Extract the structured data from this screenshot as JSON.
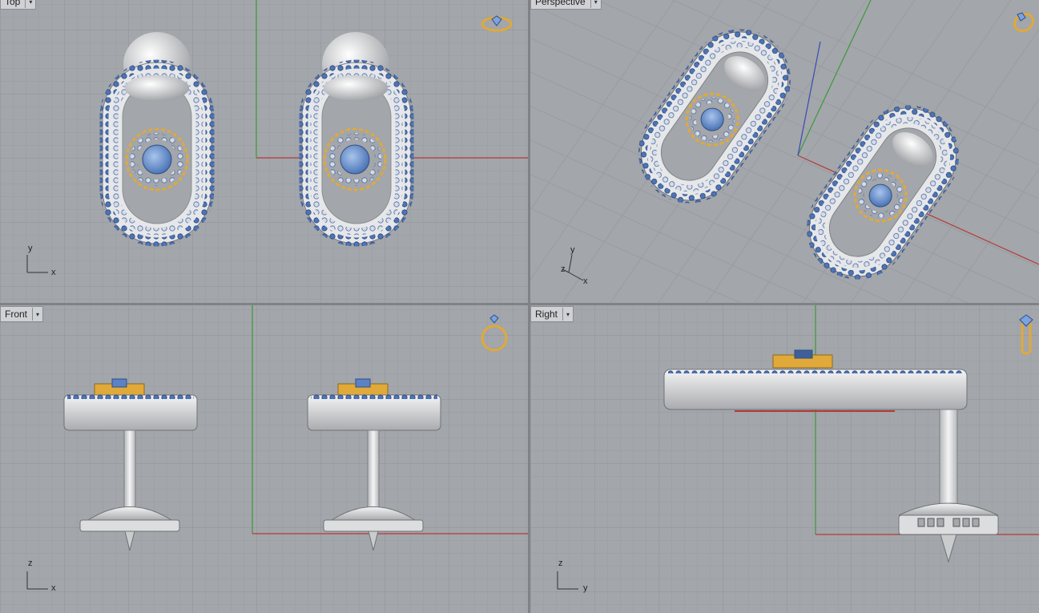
{
  "viewports": {
    "top": {
      "title": "Top",
      "dropdown": "▾",
      "axis_v": "y",
      "axis_h": "x"
    },
    "perspective": {
      "title": "Perspective",
      "dropdown": "▾",
      "axis_v": "y",
      "axis_z": "z",
      "axis_h": "x"
    },
    "front": {
      "title": "Front",
      "dropdown": "▾",
      "axis_v": "z",
      "axis_h": "x"
    },
    "right": {
      "title": "Right",
      "dropdown": "▾",
      "axis_v": "z",
      "axis_h": "y"
    }
  },
  "icons": {
    "top": "ring-top-view-icon",
    "perspective": "ring-perspective-icon",
    "front": "ring-front-view-icon",
    "right": "ring-side-view-icon"
  },
  "colors": {
    "grid_bg": "#a3a6aa",
    "grid_line": "#9a9da1",
    "grid_major": "#8e9195",
    "x_axis": "#b33a3a",
    "y_axis": "#3a9a3a",
    "z_axis": "#3a4ab3",
    "gem_blue": "#5b82c6",
    "gold": "#e0a93a",
    "metal": "#e4e5e6"
  }
}
